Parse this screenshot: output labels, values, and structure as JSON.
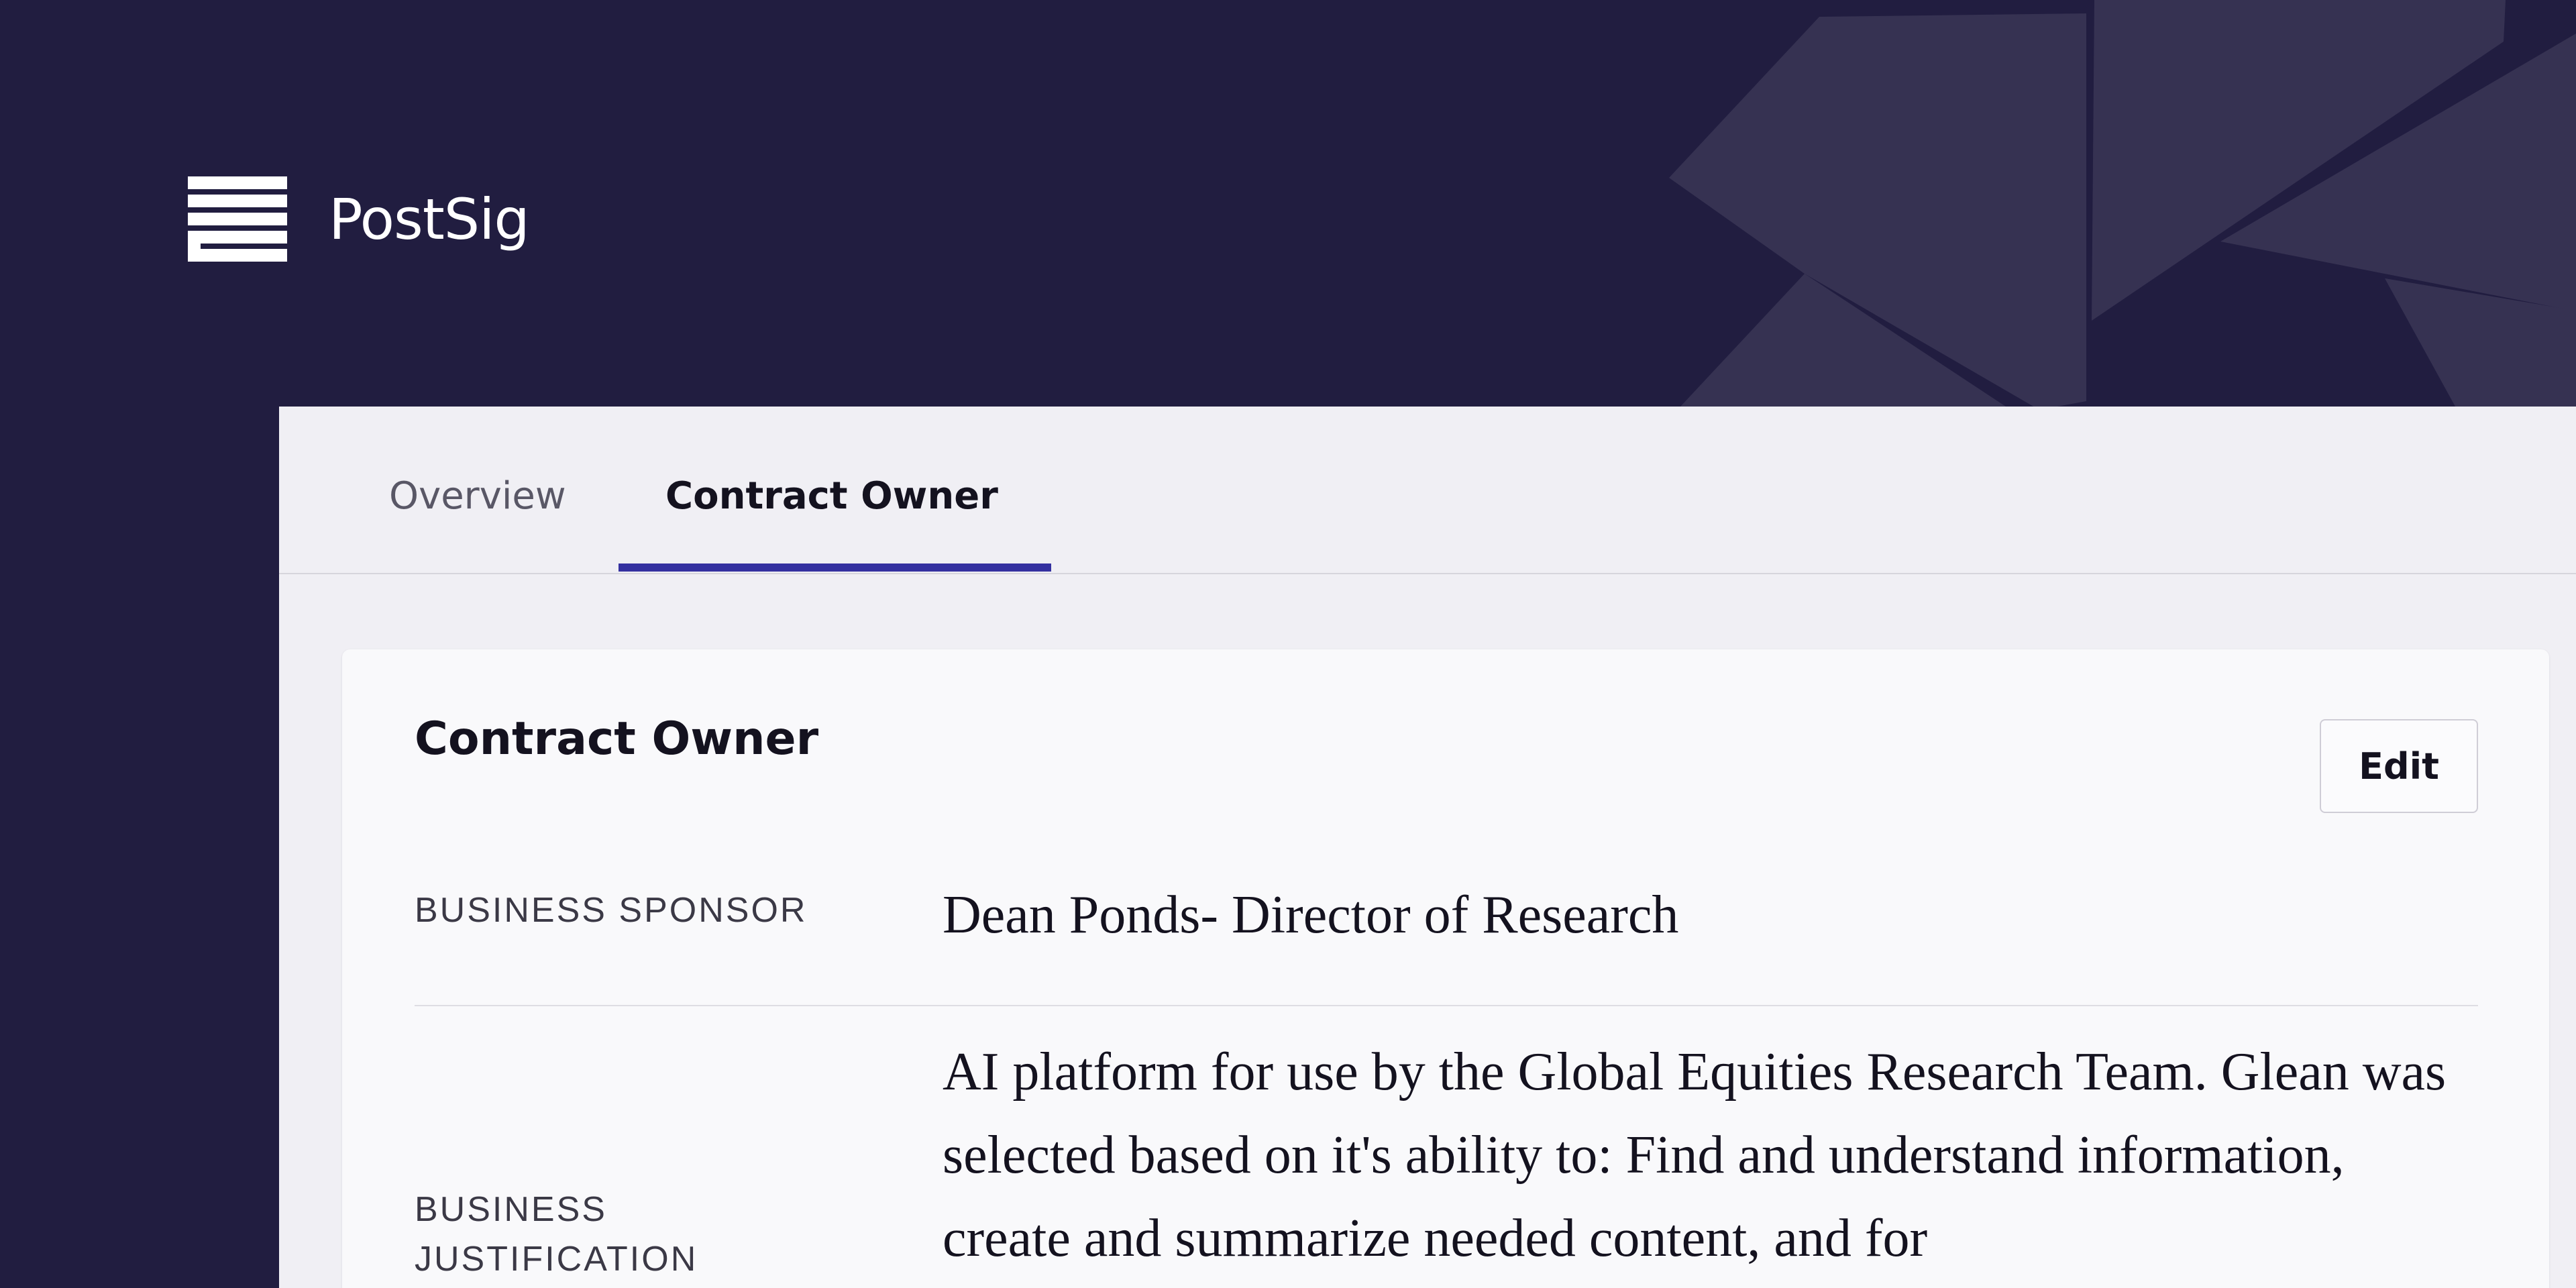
{
  "brand": {
    "name": "PostSig"
  },
  "tabs": [
    {
      "label": "Overview",
      "active": false
    },
    {
      "label": "Contract Owner",
      "active": true
    }
  ],
  "card": {
    "title": "Contract Owner",
    "edit_label": "Edit",
    "fields": [
      {
        "label": "BUSINESS SPONSOR",
        "value": "Dean Ponds- Director of Research"
      },
      {
        "label": "BUSINESS JUSTIFICATION",
        "value": "AI platform for use by the Global Equities Research Team. Glean was selected based on it's ability to: Find and understand information, create and summarize needed content, and for"
      }
    ]
  },
  "colors": {
    "header_background": "#211d40",
    "decor_shape": "#363252",
    "panel_background": "#f0eff4",
    "card_background": "#f9f9fb",
    "active_tab_underline": "#3430a0",
    "text_primary": "#14121f",
    "text_muted": "#595766"
  },
  "icons": {
    "logo": "postsig-logo-icon"
  }
}
